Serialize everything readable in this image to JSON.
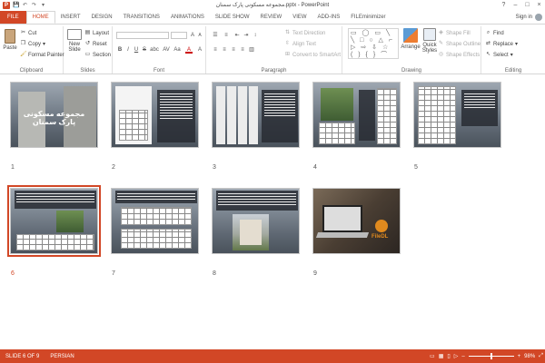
{
  "window": {
    "title": "مجموعه مسکونی پارک سمنان.pptx - PowerPoint",
    "controls": [
      "?",
      "–",
      "□",
      "×"
    ]
  },
  "qat": {
    "app_letter": "P",
    "save": "💾",
    "undo": "↶",
    "redo": "↷",
    "customize": "▾"
  },
  "tabs": [
    "FILE",
    "HOME",
    "INSERT",
    "DESIGN",
    "TRANSITIONS",
    "ANIMATIONS",
    "SLIDE SHOW",
    "REVIEW",
    "VIEW",
    "ADD-INS",
    "FILEminimizer"
  ],
  "active_tab": "HOME",
  "signin": "Sign in",
  "ribbon": {
    "clipboard": {
      "paste": "Paste",
      "cut": "Cut",
      "copy": "Copy",
      "format_painter": "Format Painter",
      "label": "Clipboard"
    },
    "slides": {
      "new_slide": "New Slide",
      "layout": "Layout",
      "reset": "Reset",
      "section": "Section",
      "label": "Slides"
    },
    "font": {
      "label": "Font",
      "bold": "B",
      "italic": "I",
      "underline": "U",
      "strike": "S",
      "shadow": "abc",
      "spacing": "AV",
      "case": "Aa",
      "color": "A",
      "grow": "A",
      "shrink": "A",
      "clear": "A"
    },
    "paragraph": {
      "text_direction": "Text Direction",
      "align_text": "Align Text",
      "smartart": "Convert to SmartArt",
      "label": "Paragraph"
    },
    "drawing": {
      "arrange": "Arrange",
      "quick_styles": "Quick Styles",
      "shape_fill": "Shape Fill",
      "shape_outline": "Shape Outline",
      "shape_effects": "Shape Effects",
      "label": "Drawing",
      "shapes_preview": "▭ ◯ ▭ ╲ ╲ □ ○ △ ⌐ ▷ ⇨ ⇩ ☆ ( ) { } ⌒"
    },
    "editing": {
      "find": "Find",
      "replace": "Replace",
      "select": "Select",
      "label": "Editing"
    }
  },
  "slides": [
    {
      "num": "1",
      "title": "مجموعه مسکونی پارک سمنان"
    },
    {
      "num": "2"
    },
    {
      "num": "3"
    },
    {
      "num": "4"
    },
    {
      "num": "5"
    },
    {
      "num": "6",
      "selected": true
    },
    {
      "num": "7"
    },
    {
      "num": "8"
    },
    {
      "num": "9",
      "logo_text": "FileDL"
    }
  ],
  "status": {
    "slide_info": "SLIDE 6 OF 9",
    "language": "PERSIAN",
    "zoom": "98%",
    "zoom_minus": "–",
    "zoom_plus": "+"
  },
  "colors": {
    "accent": "#d24726"
  }
}
